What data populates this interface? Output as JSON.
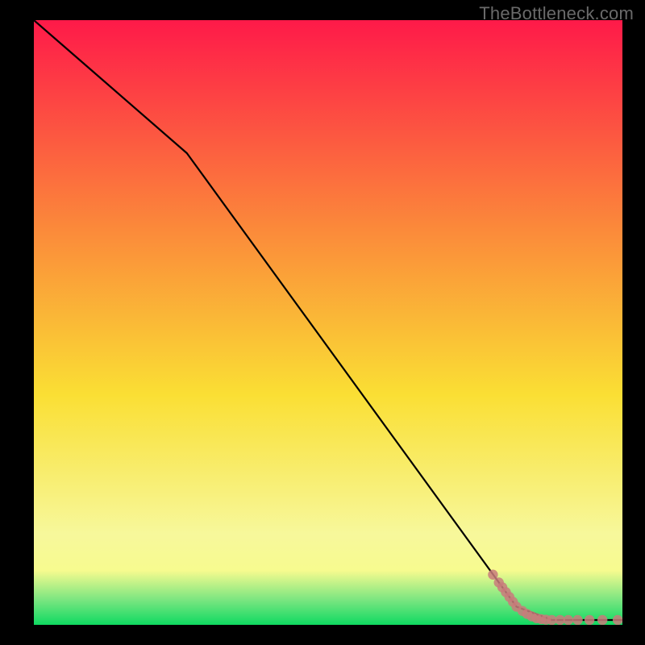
{
  "watermark": "TheBottleneck.com",
  "colors": {
    "bg_black": "#000000",
    "line": "#000000",
    "marker": "#c97b7b",
    "gradient_top": "#fe1a49",
    "gradient_upper_mid": "#fb8b3a",
    "gradient_mid": "#fadf34",
    "gradient_lower_mid": "#f7f89b",
    "gradient_band_yellow": "#f7fb8f",
    "gradient_greenish": "#77e580",
    "gradient_bottom": "#0fd961"
  },
  "chart_data": {
    "type": "line",
    "title": "",
    "xlabel": "",
    "ylabel": "",
    "xlim": [
      0,
      100
    ],
    "ylim": [
      0,
      100
    ],
    "line_points": [
      {
        "x": 0,
        "y": 100
      },
      {
        "x": 26,
        "y": 78
      },
      {
        "x": 82,
        "y": 3
      },
      {
        "x": 88,
        "y": 0.8
      },
      {
        "x": 100,
        "y": 0.8
      }
    ],
    "marker_points": [
      {
        "x": 78,
        "y": 8.3
      },
      {
        "x": 79,
        "y": 7.0
      },
      {
        "x": 79.6,
        "y": 6.2
      },
      {
        "x": 80.2,
        "y": 5.4
      },
      {
        "x": 80.8,
        "y": 4.6
      },
      {
        "x": 81.4,
        "y": 3.8
      },
      {
        "x": 82,
        "y": 3.0
      },
      {
        "x": 83,
        "y": 2.3
      },
      {
        "x": 83.8,
        "y": 1.8
      },
      {
        "x": 84.6,
        "y": 1.4
      },
      {
        "x": 85.4,
        "y": 1.1
      },
      {
        "x": 86.2,
        "y": 0.95
      },
      {
        "x": 87,
        "y": 0.85
      },
      {
        "x": 88,
        "y": 0.8
      },
      {
        "x": 89.4,
        "y": 0.8
      },
      {
        "x": 90.8,
        "y": 0.8
      },
      {
        "x": 92.4,
        "y": 0.8
      },
      {
        "x": 94.4,
        "y": 0.8
      },
      {
        "x": 96.6,
        "y": 0.8
      },
      {
        "x": 99.2,
        "y": 0.8
      }
    ]
  }
}
